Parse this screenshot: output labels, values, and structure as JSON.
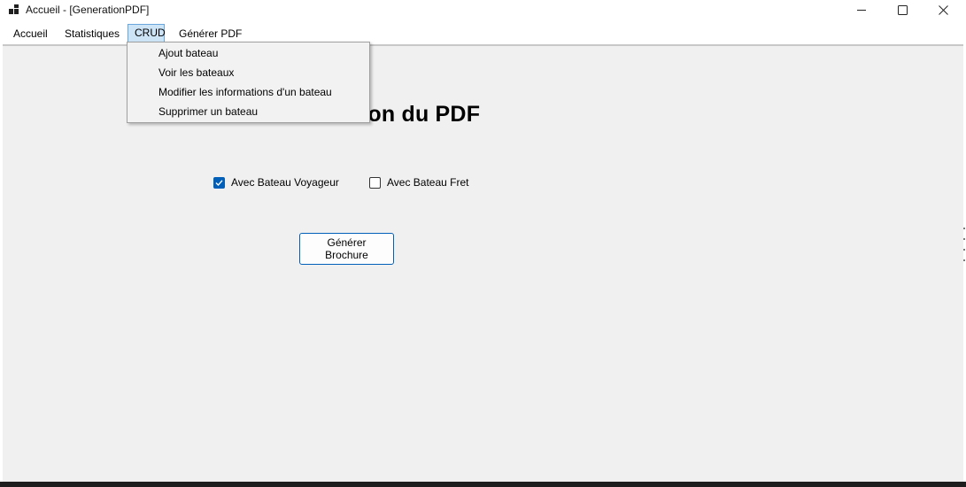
{
  "window": {
    "title": "Accueil - [GenerationPDF]",
    "icon": "app-icon"
  },
  "caption_buttons": {
    "minimize": "minimize-icon",
    "maximize": "maximize-icon",
    "close": "close-icon"
  },
  "menu": {
    "items": [
      "Accueil",
      "Statistiques",
      "CRUD",
      "Générer PDF"
    ],
    "open_menu": "CRUD"
  },
  "crud_menu": {
    "items": [
      "Ajout bateau",
      "Voir les bateaux",
      "Modifier les informations d'un bateau",
      "Supprimer un bateau"
    ]
  },
  "main": {
    "heading_visible": "ation du PDF",
    "checkboxes": [
      {
        "label": "Avec Bateau Voyageur",
        "checked": true
      },
      {
        "label": "Avec Bateau Fret",
        "checked": false
      }
    ],
    "generate_button": "Générer Brochure"
  },
  "colors": {
    "accent": "#005fb8",
    "menu_highlight": "#cde4f7",
    "client_bg": "#f0f0f0"
  }
}
